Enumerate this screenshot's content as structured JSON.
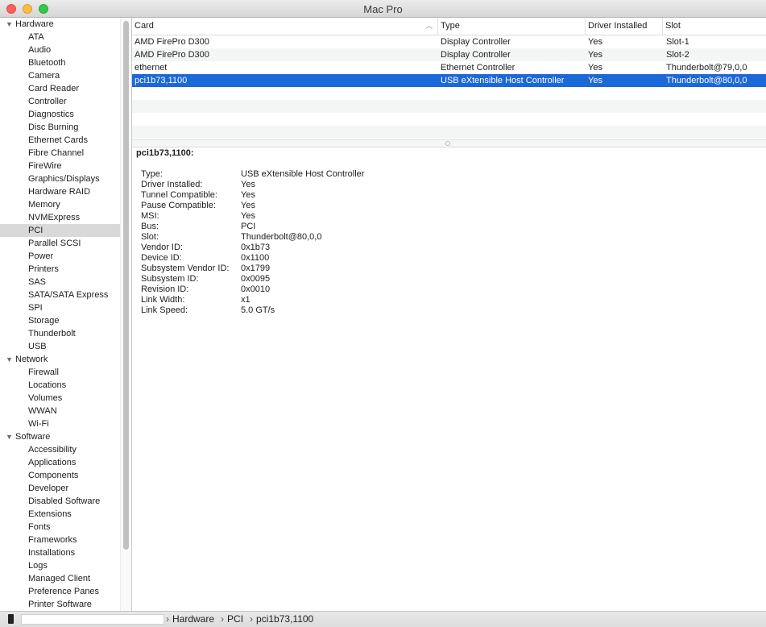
{
  "window": {
    "title": "Mac Pro"
  },
  "sidebar": {
    "categories": [
      {
        "label": "Hardware",
        "items": [
          "ATA",
          "Audio",
          "Bluetooth",
          "Camera",
          "Card Reader",
          "Controller",
          "Diagnostics",
          "Disc Burning",
          "Ethernet Cards",
          "Fibre Channel",
          "FireWire",
          "Graphics/Displays",
          "Hardware RAID",
          "Memory",
          "NVMExpress",
          "PCI",
          "Parallel SCSI",
          "Power",
          "Printers",
          "SAS",
          "SATA/SATA Express",
          "SPI",
          "Storage",
          "Thunderbolt",
          "USB"
        ]
      },
      {
        "label": "Network",
        "items": [
          "Firewall",
          "Locations",
          "Volumes",
          "WWAN",
          "Wi-Fi"
        ]
      },
      {
        "label": "Software",
        "items": [
          "Accessibility",
          "Applications",
          "Components",
          "Developer",
          "Disabled Software",
          "Extensions",
          "Fonts",
          "Frameworks",
          "Installations",
          "Logs",
          "Managed Client",
          "Preference Panes",
          "Printer Software"
        ]
      }
    ],
    "selected": "PCI"
  },
  "table": {
    "columns": [
      "Card",
      "Type",
      "Driver Installed",
      "Slot"
    ],
    "rows": [
      [
        "AMD FirePro D300",
        "Display Controller",
        "Yes",
        "Slot-1"
      ],
      [
        "AMD FirePro D300",
        "Display Controller",
        "Yes",
        "Slot-2"
      ],
      [
        "ethernet",
        "Ethernet Controller",
        "Yes",
        "Thunderbolt@79,0,0"
      ],
      [
        "pci1b73,1100",
        "USB eXtensible Host Controller",
        "Yes",
        "Thunderbolt@80,0,0"
      ]
    ],
    "selected_row": 3
  },
  "detail": {
    "title": "pci1b73,1100:",
    "fields": [
      {
        "key": "Type:",
        "value": "USB eXtensible Host Controller"
      },
      {
        "key": "Driver Installed:",
        "value": "Yes"
      },
      {
        "key": "Tunnel Compatible:",
        "value": "Yes"
      },
      {
        "key": "Pause Compatible:",
        "value": "Yes"
      },
      {
        "key": "MSI:",
        "value": "Yes"
      },
      {
        "key": "Bus:",
        "value": "PCI"
      },
      {
        "key": "Slot:",
        "value": "Thunderbolt@80,0,0"
      },
      {
        "key": "Vendor ID:",
        "value": "0x1b73"
      },
      {
        "key": "Device ID:",
        "value": "0x1100"
      },
      {
        "key": "Subsystem Vendor ID:",
        "value": "0x1799"
      },
      {
        "key": "Subsystem ID:",
        "value": "0x0095"
      },
      {
        "key": "Revision ID:",
        "value": "0x0010"
      },
      {
        "key": "Link Width:",
        "value": "x1"
      },
      {
        "key": "Link Speed:",
        "value": "5.0 GT/s"
      }
    ]
  },
  "statusbar": {
    "breadcrumb": [
      "Hardware",
      "PCI",
      "pci1b73,1100"
    ]
  },
  "colors": {
    "selection": "#1c68d8",
    "sidebar_selection": "#d9d9d9"
  }
}
